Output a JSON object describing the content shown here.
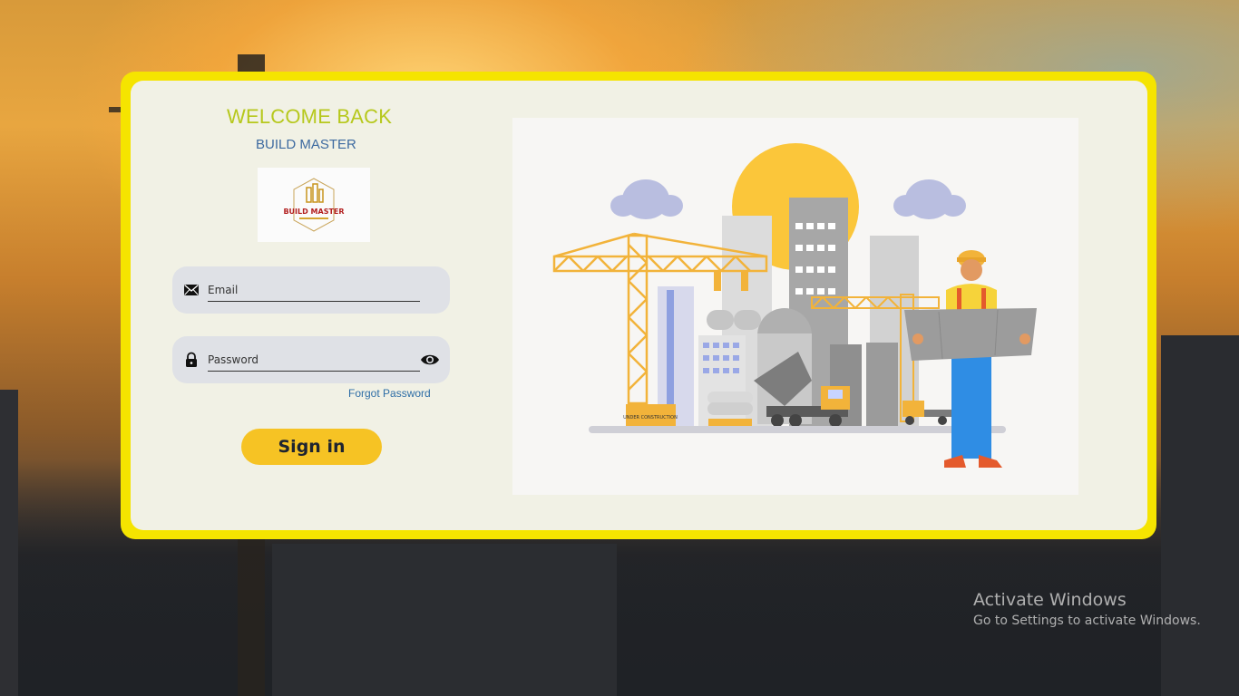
{
  "login": {
    "welcome": "WELCOME BACK",
    "brand": "BUILD MASTER",
    "logo_text": "BUILD MASTER",
    "email_placeholder": "Email",
    "password_placeholder": "Password",
    "forgot_password": "Forgot Password",
    "sign_in": "Sign in"
  },
  "illustration": {
    "sign_text": "UNDER CONSTRUCTION"
  },
  "watermark": {
    "title": "Activate Windows",
    "subtitle": "Go to Settings to activate Windows."
  },
  "icons": [
    "mail-icon",
    "lock-icon",
    "eye-icon"
  ],
  "colors": {
    "frame": "#f5e400",
    "accent": "#f6c324",
    "welcome": "#b6c81c",
    "brand": "#3d6aa0"
  }
}
